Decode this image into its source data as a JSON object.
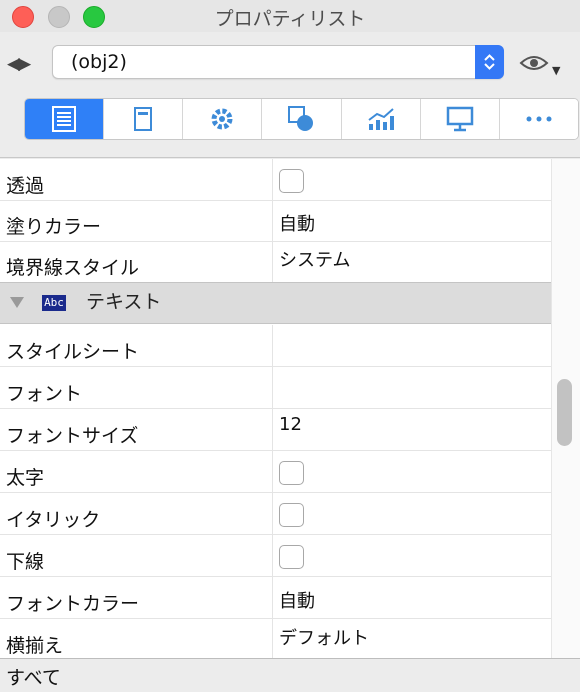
{
  "window": {
    "title": "プロパティリスト"
  },
  "toolbar": {
    "nav_icon": "back-forward-arrows",
    "nav_glyph": "◀▶",
    "object_selector": {
      "value": "(obj2)"
    },
    "view_menu_icon": "eye-icon",
    "tabs": [
      {
        "icon": "list-icon",
        "active": true
      },
      {
        "icon": "object-icon",
        "active": false
      },
      {
        "icon": "gear-icon",
        "active": false
      },
      {
        "icon": "shapes-icon",
        "active": false
      },
      {
        "icon": "chart-icon",
        "active": false
      },
      {
        "icon": "monitor-icon",
        "active": false
      },
      {
        "icon": "more-icon",
        "active": false
      }
    ]
  },
  "properties": {
    "rows_top": [
      {
        "name": "透過",
        "type": "checkbox",
        "value": ""
      },
      {
        "name": "塗りカラー",
        "type": "text",
        "value": "自動"
      },
      {
        "name": "境界線スタイル",
        "type": "text",
        "value": "システム"
      }
    ],
    "section": {
      "label": "テキスト",
      "icon_text": "Abc"
    },
    "rows_text": [
      {
        "name": "スタイルシート",
        "type": "text",
        "value": ""
      },
      {
        "name": "フォント",
        "type": "text",
        "value": ""
      },
      {
        "name": "フォントサイズ",
        "type": "text",
        "value": "12"
      },
      {
        "name": "太字",
        "type": "checkbox",
        "value": ""
      },
      {
        "name": "イタリック",
        "type": "checkbox",
        "value": ""
      },
      {
        "name": "下線",
        "type": "checkbox",
        "value": ""
      },
      {
        "name": "フォントカラー",
        "type": "text",
        "value": "自動"
      },
      {
        "name": "横揃え",
        "type": "text",
        "value": "デフォルト"
      }
    ]
  },
  "status": {
    "filter": "すべて"
  },
  "colors": {
    "accent": "#2f80f7",
    "section_bg": "#dcdcdc"
  }
}
